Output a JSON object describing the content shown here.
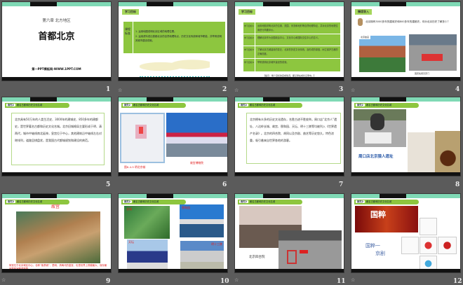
{
  "slides": [
    {
      "n": "1",
      "chapter": "第六章  北方地区",
      "title": "首都北京",
      "footer": "第一PPT模板网-WWW.1PPT.COM"
    },
    {
      "n": "2",
      "tag": "学习目标",
      "side": "课程标准",
      "lines": [
        "1. 运用地图说明北京区域的地理位置。",
        "2. 运用资料说出首都北京的自然地理特点、历史文化传统和城市职能，并举例说明其城市建设成就。"
      ]
    },
    {
      "n": "3",
      "tag": "学习目标",
      "rows": [
        {
          "k": "学习目标1",
          "v": "运用地图说明北京的位置、范围、河流和地形等自然地理特征，并对北京的地理位置进行简要评价。"
        },
        {
          "k": "学习目标2",
          "v": "理解北京作为全国政治中心、文化中心和国际交往中心的意义。"
        },
        {
          "k": "学习目标3",
          "v": "了解北京古城建设的变迁、北京的历史文化传统，及形成的原因，树立保护古都的正确态度。"
        },
        {
          "k": "学习目标4",
          "v": "举例说明北京城市建设的成就。"
        }
      ],
      "note": "【提示：每个目标的完成情况，都记录在成长记录中。】"
    },
    {
      "n": "4",
      "tag": "情境导入",
      "q": "北京拥有3000多年的建城史和800多年的建都史。你对北京历史了解多少？",
      "cap1": "北京故宫",
      "cap2": "国庆检阅天安门"
    },
    {
      "n": "5",
      "pill_k": "探究2",
      "pill": "著名古都和历史文化名城",
      "body": "北京具有50万年的人类生活史、3000年的建城史、850多年的建都史，是世界著名古都和历史文化名城。北京旧城格局主要形成于明、清两代，城市中轴线南北延伸，皇宫位于中心，其他建筑沿中轴线左右对称排列，道路呈棋盘状，是我国古代都城规划和建设的典范。"
    },
    {
      "n": "6",
      "pill_k": "探究2",
      "pill": "著名古都和历史文化名城",
      "cap1": "图6-4-5 明北京城",
      "cap2": "故宫博物院"
    },
    {
      "n": "7",
      "pill_k": "探究2",
      "pill": "著名古都和历史文化名城",
      "body": "北京拥有众多的历史文化遗存，名胜古迹不胜枚举。周口店“北京人”遗址、八达岭长城、故宫、颐和园、天坛、明十三陵等均被列入《世界遗产名录》。北京的四合院、胡同以及京剧、曲艺等历史悠久，特色浓重，吸引着来自世界各地的游客。"
    },
    {
      "n": "8",
      "pill_k": "探究2",
      "pill": "著名古都和历史文化名城",
      "cap": "周口店北京猿人遗址"
    },
    {
      "n": "9",
      "pill_k": "探究2",
      "pill": "著名古都和历史文化名城",
      "title": "故宫",
      "body": "故宫位于北京城区中心，也称“紫禁城”，是明、清两代的皇宫，也是世界上规模最大、保存最完整的宫殿建筑群。"
    },
    {
      "n": "10",
      "pill_k": "探究2",
      "pill": "著名古都和历史文化名城",
      "l1": "长城",
      "l2": "颐和园",
      "l3": "天坛",
      "l4": "明十三陵"
    },
    {
      "n": "11",
      "pill_k": "探究2",
      "pill": "著名古都和历史文化名城",
      "cap": "北京四合院"
    },
    {
      "n": "12",
      "pill_k": "探究2",
      "pill": "著名古都和历史文化名城",
      "banner": "国粹",
      "cap1": "国粹一",
      "cap2": "京剧"
    }
  ],
  "colors": {
    "background": "#5b5b5b",
    "accent": "#7fd9b5",
    "green": "#8dc63f"
  }
}
